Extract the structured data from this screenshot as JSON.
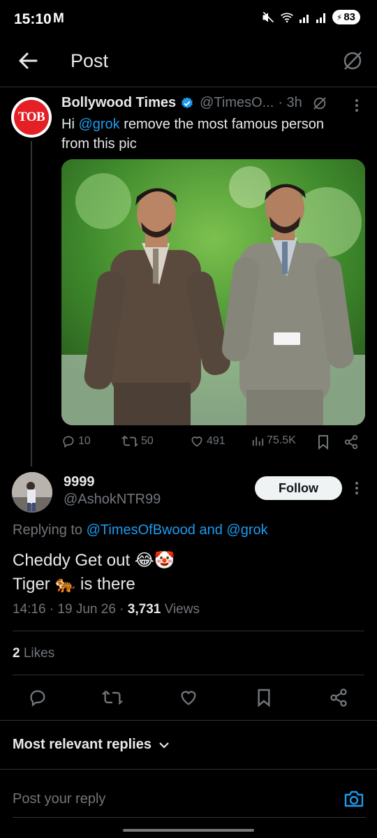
{
  "status": {
    "time": "15:10",
    "carrier_icon": "M",
    "battery": "83"
  },
  "header": {
    "title": "Post"
  },
  "tweet": {
    "author_name": "Bollywood Times",
    "author_handle": "@TimesO...",
    "time_ago": "· 3h",
    "avatar_text": "TOB",
    "text_prefix": "Hi",
    "mention": "@grok",
    "text_rest": "remove the most famous person from this pic",
    "stats": {
      "replies": "10",
      "reposts": "50",
      "likes": "491",
      "views": "75.5K"
    }
  },
  "reply": {
    "name": "9999",
    "handle": "@AshokNTR99",
    "follow_label": "Follow",
    "replying_label": "Replying to",
    "replying_to_1": "@TimesOfBwood",
    "replying_and": "and",
    "replying_to_2": "@grok",
    "line1": "Cheddy Get out 😂🤡",
    "line2": "Tiger 🐅 is there",
    "timestamp": "14:16 · 19 Jun 26 ·",
    "views_count": "3,731",
    "views_label": "Views",
    "likes_count": "2",
    "likes_label": "Likes"
  },
  "sort": {
    "label": "Most relevant replies"
  },
  "composer": {
    "placeholder": "Post your reply"
  },
  "colors": {
    "accent": "#1d9bf0",
    "muted": "#71767b",
    "text": "#e7e9ea"
  }
}
